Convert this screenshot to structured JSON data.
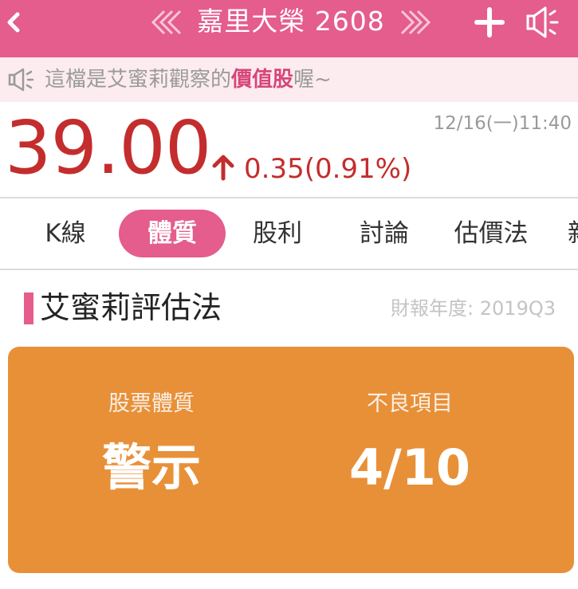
{
  "header": {
    "stock_title": "嘉里大榮 2608"
  },
  "notice": {
    "text_prefix": "這檔是艾蜜莉觀察的",
    "highlight": "價值股",
    "text_suffix": "喔~"
  },
  "quote": {
    "price": "39.00",
    "change": "0.35(0.91%)",
    "timestamp": "12/16(一)11:40",
    "direction": "up",
    "up_color": "#c42d2d"
  },
  "tabs": [
    {
      "label": "K線",
      "active": false
    },
    {
      "label": "體質",
      "active": true
    },
    {
      "label": "股利",
      "active": false
    },
    {
      "label": "討論",
      "active": false
    },
    {
      "label": "估價法",
      "active": false
    },
    {
      "label": "新",
      "active": false
    }
  ],
  "section": {
    "title": "艾蜜莉評估法",
    "report_period": "財報年度: 2019Q3"
  },
  "evaluation": {
    "health_label": "股票體質",
    "health_value": "警示",
    "bad_items_label": "不良項目",
    "bad_items_value": "4/10"
  },
  "colors": {
    "brand_pink": "#e45d8c",
    "warning_orange": "#e89038"
  },
  "icons": {
    "back": "chevron-left-icon",
    "prev": "double-chevron-left-icon",
    "next": "double-chevron-right-icon",
    "add": "plus-icon",
    "speaker": "megaphone-icon"
  }
}
